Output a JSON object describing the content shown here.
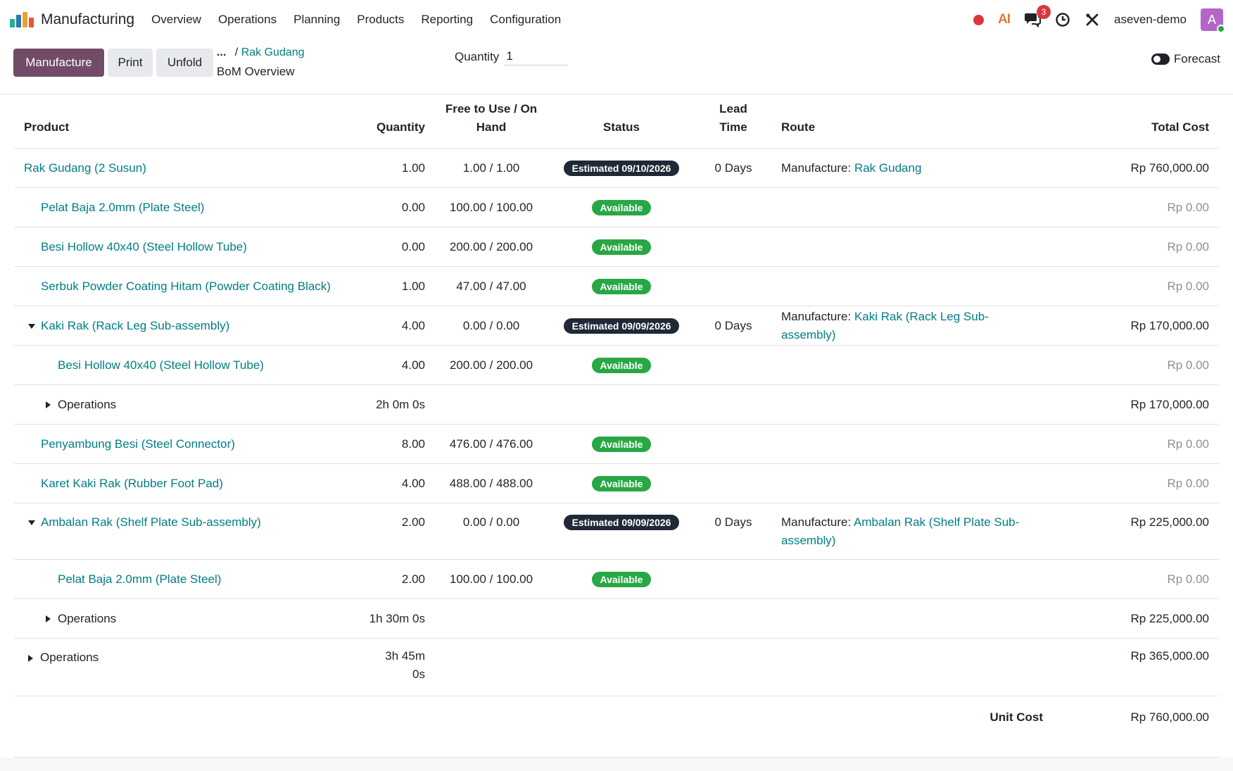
{
  "navbar": {
    "app_name": "Manufacturing",
    "menu": [
      "Overview",
      "Operations",
      "Planning",
      "Products",
      "Reporting",
      "Configuration"
    ],
    "ai_label": "AI",
    "chat_count": "3",
    "user": "aseven-demo",
    "avatar_letter": "A"
  },
  "control": {
    "manufacture": "Manufacture",
    "print": "Print",
    "unfold": "Unfold",
    "crumb_dots": "...",
    "crumb_sep": "/",
    "crumb_link": "Rak Gudang",
    "page_title": "BoM Overview",
    "quantity_label": "Quantity",
    "quantity_value": "1",
    "forecast": "Forecast"
  },
  "table": {
    "headers": {
      "product": "Product",
      "quantity": "Quantity",
      "free_line1": "Free to Use / On",
      "free_line2": "Hand",
      "status": "Status",
      "lead_line1": "Lead",
      "lead_line2": "Time",
      "route": "Route",
      "cost": "Total Cost"
    },
    "route_prefix": "Manufacture: ",
    "rows": [
      {
        "product": "Rak Gudang (2 Susun)",
        "qty": "1.00",
        "free": "1.00 / 1.00",
        "status": "Estimated 09/10/2026",
        "lead": "0 Days",
        "route": "Rak Gudang",
        "cost": "Rp 760,000.00"
      },
      {
        "product": "Pelat Baja 2.0mm (Plate Steel)",
        "qty": "0.00",
        "free": "100.00 / 100.00",
        "status": "Available",
        "cost": "Rp 0.00"
      },
      {
        "product": "Besi Hollow 40x40 (Steel Hollow Tube)",
        "qty": "0.00",
        "free": "200.00 / 200.00",
        "status": "Available",
        "cost": "Rp 0.00"
      },
      {
        "product": "Serbuk Powder Coating Hitam (Powder Coating Black)",
        "qty": "1.00",
        "free": "47.00 / 47.00",
        "status": "Available",
        "cost": "Rp 0.00"
      },
      {
        "product": "Kaki Rak (Rack Leg Sub-assembly)",
        "qty": "4.00",
        "free": "0.00 / 0.00",
        "status": "Estimated 09/09/2026",
        "lead": "0 Days",
        "route": "Kaki Rak (Rack Leg Sub-assembly)",
        "cost": "Rp 170,000.00"
      },
      {
        "product": "Besi Hollow 40x40 (Steel Hollow Tube)",
        "qty": "4.00",
        "free": "200.00 / 200.00",
        "status": "Available",
        "cost": "Rp 0.00"
      },
      {
        "product": "Operations",
        "qty": "2h 0m 0s",
        "cost": "Rp 170,000.00"
      },
      {
        "product": "Penyambung Besi (Steel Connector)",
        "qty": "8.00",
        "free": "476.00 / 476.00",
        "status": "Available",
        "cost": "Rp 0.00"
      },
      {
        "product": "Karet Kaki Rak (Rubber Foot Pad)",
        "qty": "4.00",
        "free": "488.00 / 488.00",
        "status": "Available",
        "cost": "Rp 0.00"
      },
      {
        "product": "Ambalan Rak (Shelf Plate Sub-assembly)",
        "qty": "2.00",
        "free": "0.00 / 0.00",
        "status": "Estimated 09/09/2026",
        "lead": "0 Days",
        "route": "Ambalan Rak (Shelf Plate Sub-assembly)",
        "cost": "Rp 225,000.00"
      },
      {
        "product": "Pelat Baja 2.0mm (Plate Steel)",
        "qty": "2.00",
        "free": "100.00 / 100.00",
        "status": "Available",
        "cost": "Rp 0.00"
      },
      {
        "product": "Operations",
        "qty": "1h 30m 0s",
        "cost": "Rp 225,000.00"
      },
      {
        "product": "Operations",
        "qty_line1": "3h 45m",
        "qty_line2": "0s",
        "cost": "Rp 365,000.00"
      }
    ],
    "unit_cost_label": "Unit Cost",
    "unit_cost_value": "Rp 760,000.00"
  },
  "colors": {
    "primary": "#714b67",
    "link": "#017e84",
    "available": "#28a745",
    "estimated": "#1f2937",
    "badge_red": "#d9363e"
  }
}
